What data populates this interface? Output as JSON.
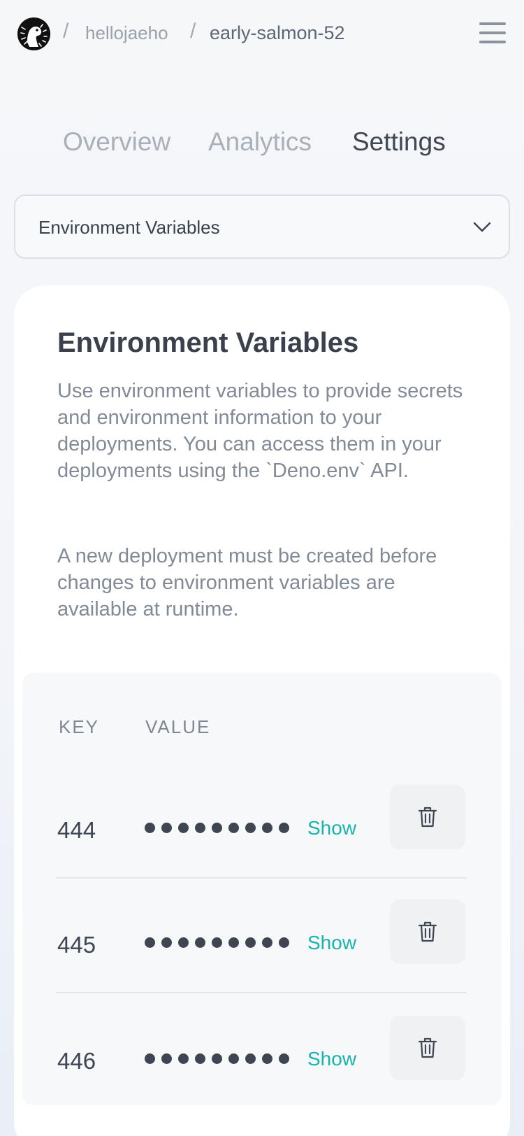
{
  "header": {
    "breadcrumb": {
      "separator": "/",
      "user": "hellojaeho",
      "project": "early-salmon-52"
    },
    "logo_icon": "deno-dinosaur-logo",
    "menu_icon": "hamburger-menu-icon"
  },
  "tabs": [
    {
      "label": "Overview",
      "active": false
    },
    {
      "label": "Analytics",
      "active": false
    },
    {
      "label": "Settings",
      "active": true
    }
  ],
  "section_select": {
    "selected": "Environment Variables",
    "icon": "chevron-down-icon"
  },
  "env_section": {
    "title": "Environment Variables",
    "description": "Use environment variables to provide secrets and environment information to your deployments. You can access them in your deployments using the `Deno.env` API.",
    "note": "A new deployment must be created before changes to environment variables are available at runtime.",
    "table": {
      "headers": {
        "key": "KEY",
        "value": "VALUE"
      },
      "rows": [
        {
          "key": "444",
          "masked_dots": 9,
          "show_label": "Show",
          "delete_icon": "trash-icon"
        },
        {
          "key": "445",
          "masked_dots": 9,
          "show_label": "Show",
          "delete_icon": "trash-icon"
        },
        {
          "key": "446",
          "masked_dots": 9,
          "show_label": "Show",
          "delete_icon": "trash-icon"
        }
      ]
    }
  },
  "colors": {
    "accent": "#19b3ad",
    "text_primary": "#3f4652",
    "text_muted": "#828a96",
    "card_bg": "#ffffff",
    "table_bg": "#f7f8fa"
  }
}
